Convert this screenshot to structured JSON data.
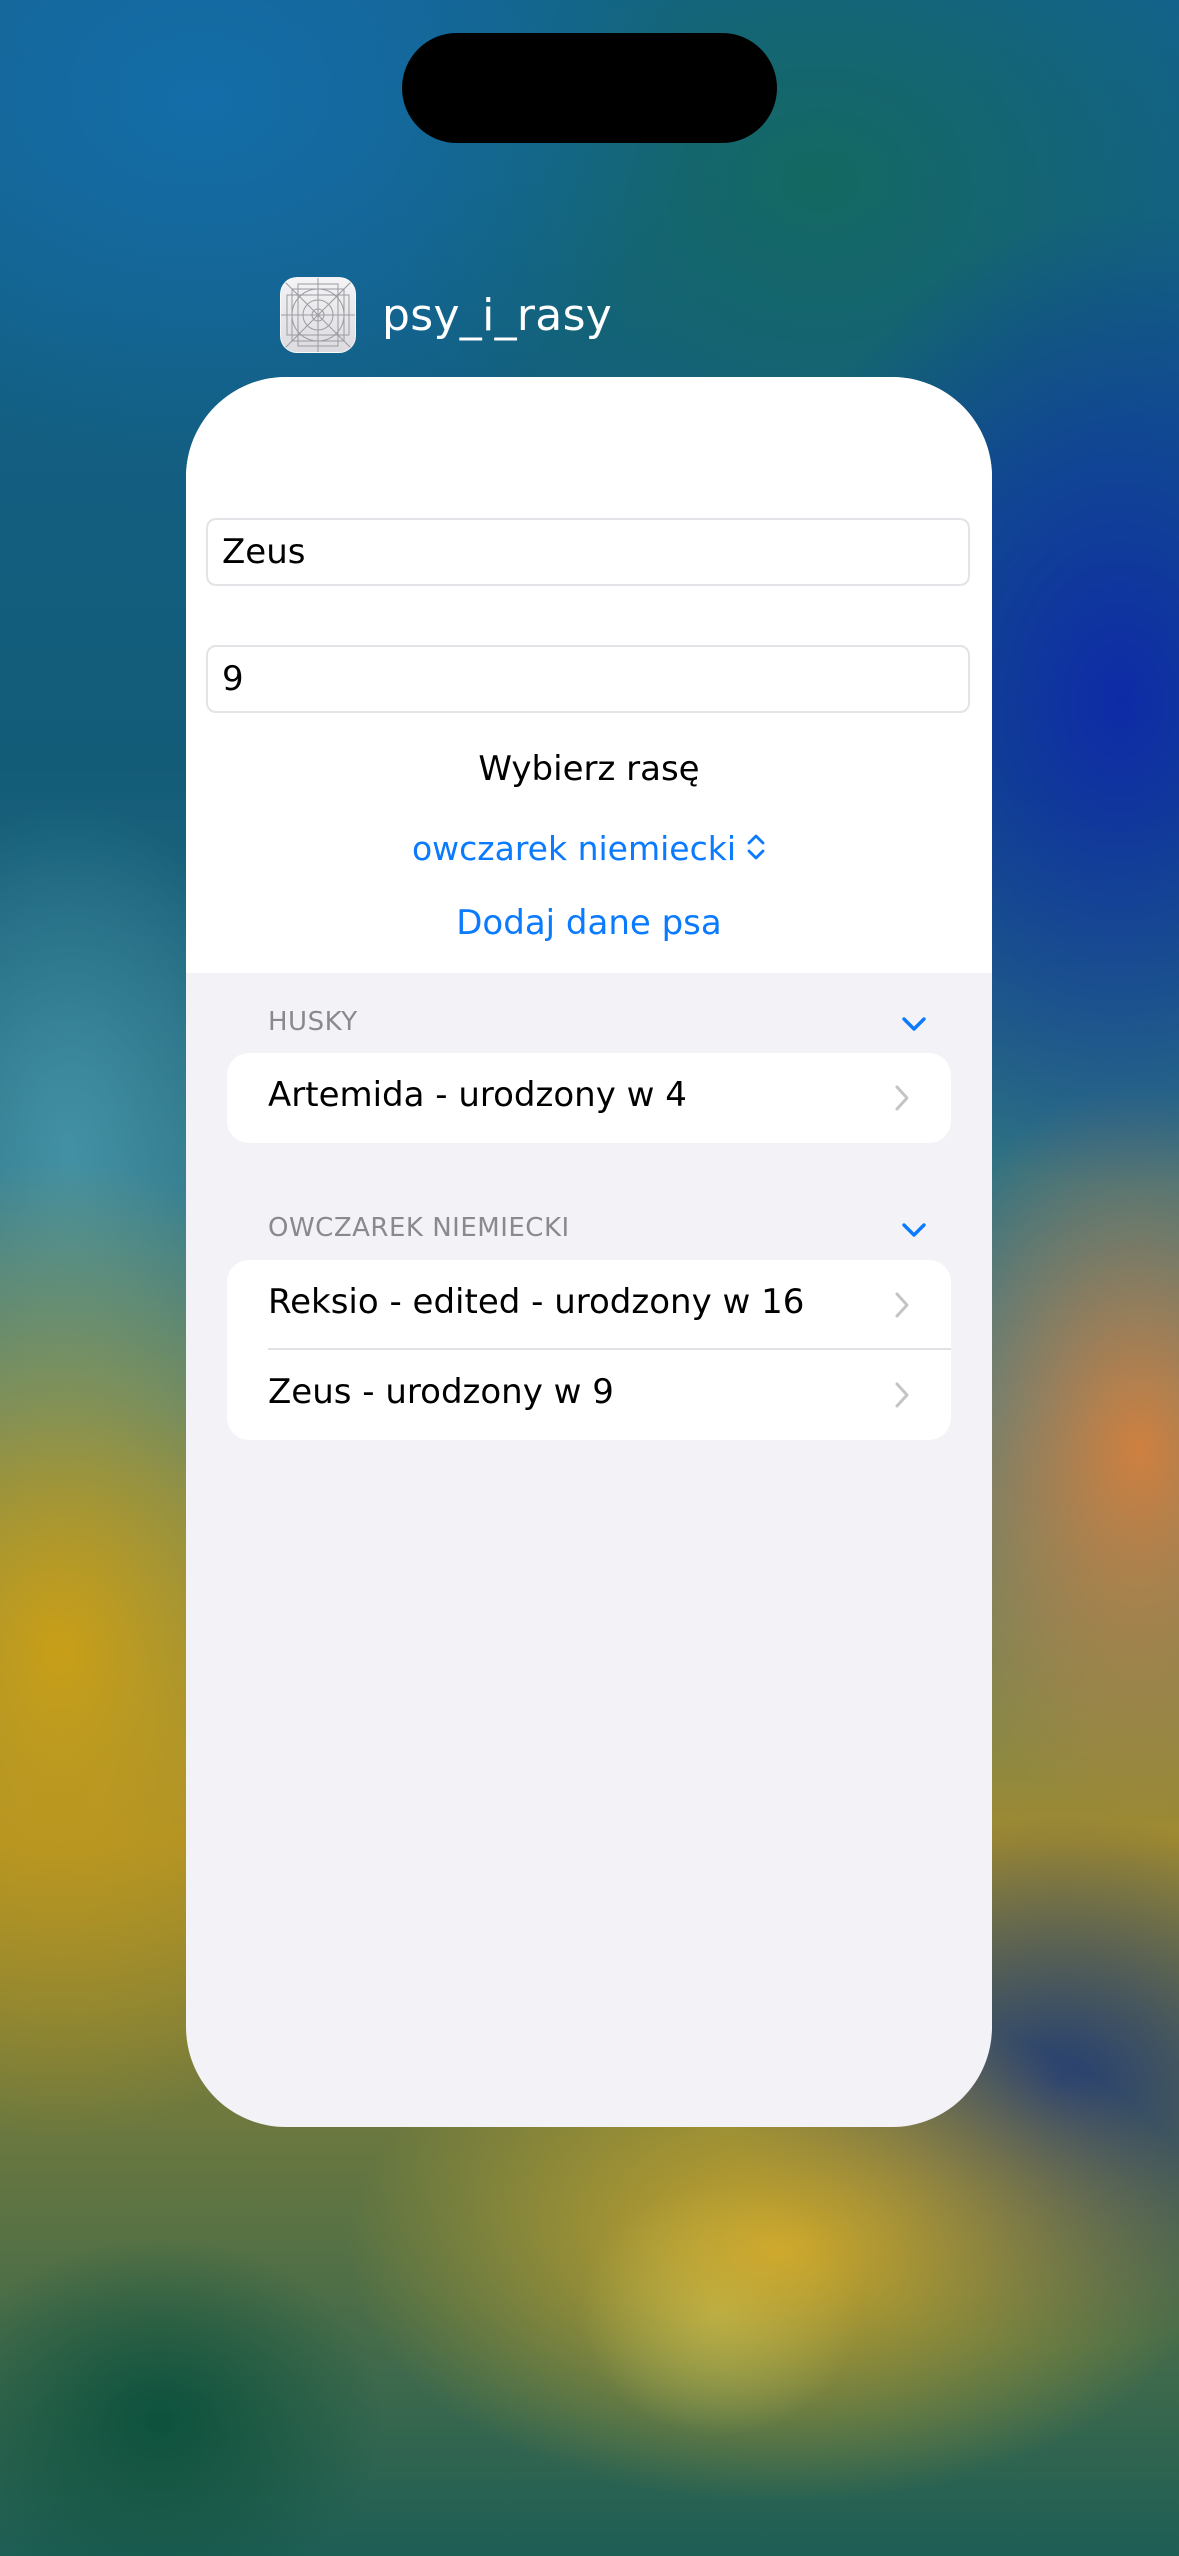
{
  "app": {
    "name": "psy_i_rasy",
    "icon": "app-placeholder-icon"
  },
  "form": {
    "name_value": "Zeus",
    "age_value": "9",
    "breed_picker_label": "Wybierz rasę",
    "breed_picker_value": "owczarek niemiecki",
    "add_button_label": "Dodaj dane psa"
  },
  "sections": [
    {
      "header": "HUSKY",
      "rows": [
        {
          "label": "Artemida - urodzony w 4"
        }
      ]
    },
    {
      "header": "OWCZAREK NIEMIECKI",
      "rows": [
        {
          "label": "Reksio - edited - urodzony w 16"
        },
        {
          "label": "Zeus - urodzony w 9"
        }
      ]
    }
  ],
  "colors": {
    "accent": "#0a7aff",
    "section_header": "#8a8a8e",
    "grouped_background": "#f2f2f7"
  }
}
